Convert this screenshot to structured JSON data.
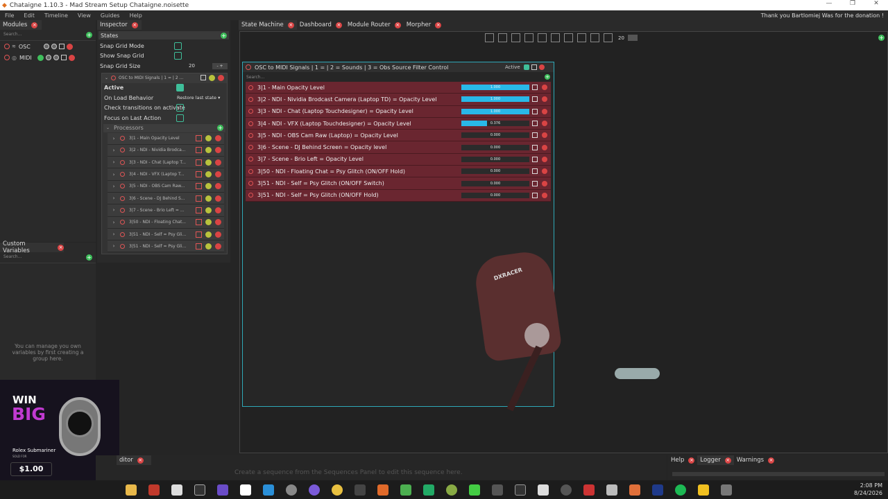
{
  "app": {
    "title": "Chataigne 1.10.3 - Mad Stream Setup Chataigne.noisette",
    "thanks": "Thank you Bartlomiej Was for the donation !"
  },
  "menu": [
    "File",
    "Edit",
    "Timeline",
    "View",
    "Guides",
    "Help"
  ],
  "modules": {
    "title": "Modules",
    "search": "Search...",
    "items": [
      {
        "name": "OSC"
      },
      {
        "name": "MIDI"
      }
    ]
  },
  "custom_vars": {
    "title": "Custom Variables",
    "search": "Search...",
    "empty": "You can manage you own variables by first creating a group here."
  },
  "inspector": {
    "title": "Inspector",
    "section": "States",
    "snap_grid_mode": "Snap Grid Mode",
    "show_snap_grid": "Show Snap Grid",
    "snap_grid_size_label": "Snap Grid Size",
    "snap_grid_size": "20",
    "state_name": "OSC to MIDI Signals | 1 = | 2 ...",
    "active": "Active",
    "on_load": "On Load Behavior",
    "on_load_value": "Restore last state",
    "check_transitions": "Check transitions on activate",
    "focus_last": "Focus on Last Action",
    "processors": "Processors",
    "processor_items": [
      "3|1 - Main Opacity Level",
      "3|2 - NDI - Nividia Brodca...",
      "3|3 - NDI - Chat (Laptop T...",
      "3|4 - NDI - VFX (Laptop T...",
      "3|5 - NDI - OBS Cam Raw...",
      "3|6 - Scene - DJ Behind S...",
      "3|7 - Scene - Brio Left = ...",
      "3|50 - NDI - Floating Chat...",
      "3|51 - NDI - Self = Psy Gli...",
      "3|51 - NDI - Self = Psy Gli..."
    ]
  },
  "tabs": [
    "State Machine",
    "Dashboard",
    "Module Router",
    "Morpher"
  ],
  "toolbar": {
    "grid_size": "20"
  },
  "state": {
    "title": "OSC to MIDI Signals | 1 =  | 2 = Sounds | 3 = Obs Source Filter Control",
    "active_label": "Active",
    "search": "Search...",
    "rows": [
      {
        "label": "3|1 - Main Opacity Level",
        "value": 1.0,
        "text": "1.000"
      },
      {
        "label": "3|2 - NDI - Nividia Brodcast Camera (Laptop TD) = Opacity Level",
        "value": 1.0,
        "text": "1.000"
      },
      {
        "label": "3|3 - NDI - Chat (Laptop Touchdesigner) = Opacity Level",
        "value": 1.0,
        "text": "1.000"
      },
      {
        "label": "3|4 - NDI - VFX (Laptop Touchdesigner) = Opacity Level",
        "value": 0.376,
        "text": "0.376"
      },
      {
        "label": "3|5 - NDI - OBS Cam Raw (Laptop) = Opacity Level",
        "value": 0,
        "text": "0.000"
      },
      {
        "label": "3|6 - Scene - DJ Behind Screen = Opacity level",
        "value": 0,
        "text": "0.000"
      },
      {
        "label": "3|7 - Scene - Brio Left = Opacity Level",
        "value": 0,
        "text": "0.000"
      },
      {
        "label": "3|50 - NDI - Floating Chat = Psy Glitch (ON/OFF Hold)",
        "value": 0,
        "text": "0.000"
      },
      {
        "label": "3|51 - NDI - Self = Psy Glitch (ON/OFF Switch)",
        "value": 0,
        "text": "0.000"
      },
      {
        "label": "3|51 - NDI - Self = Psy Glitch (ON/OFF Hold)",
        "value": 0,
        "text": "0.000"
      }
    ]
  },
  "bottom": {
    "editor": "ditor",
    "hint": "Create a sequence from the Sequences Panel to edit this sequence here.",
    "help": "Help",
    "logger": "Logger",
    "warnings": "Warnings"
  },
  "promo": {
    "win": "WIN",
    "big": "BIG",
    "product": "Rolex Submariner",
    "sold": "SOLD FOR",
    "price": "$1.00"
  },
  "tray": {
    "time": "2:08 PM",
    "date": "8/24/2026"
  }
}
